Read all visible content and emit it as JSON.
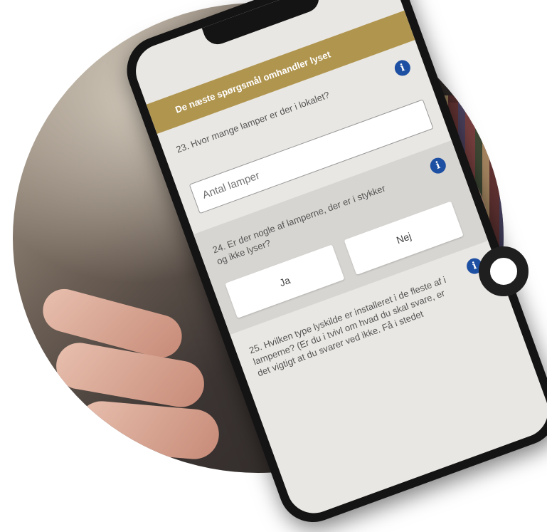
{
  "survey": {
    "section_title": "De næste spørgsmål omhandler lyset",
    "q23": {
      "text": "23. Hvor mange lamper er der i lokalet?",
      "placeholder": "Antal lamper"
    },
    "q24": {
      "text": "24. Er der nogle af lamperne, der er i stykker og ikke lyser?",
      "yes_label": "Ja",
      "no_label": "Nej"
    },
    "q25": {
      "text": "25. Hvilken type lyskilde er installeret i de fleste af i lamperne? (Er du i tvivl om hvad du skal svare, er det vigtigt at du svarer ved ikke. Få i stedet"
    },
    "info_glyph": "i"
  },
  "colors": {
    "section_band": "#b0954f",
    "info_icon": "#1d4fa2",
    "ring": "#1f1f1f"
  }
}
